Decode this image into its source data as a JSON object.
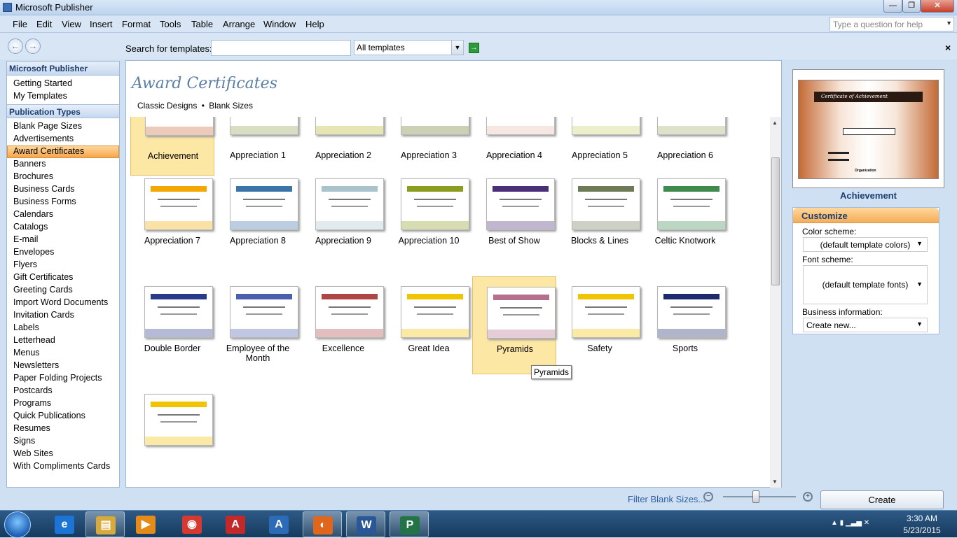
{
  "window": {
    "title": "Microsoft Publisher",
    "min_glyph": "—",
    "max_glyph": "❐",
    "close_glyph": "✕"
  },
  "menu": [
    "File",
    "Edit",
    "View",
    "Insert",
    "Format",
    "Tools",
    "Table",
    "Arrange",
    "Window",
    "Help"
  ],
  "help_box": {
    "placeholder": "Type a question for help"
  },
  "toolbar": {
    "back_glyph": "←",
    "forward_glyph": "→",
    "search_label": "Search for templates:",
    "search_value": "",
    "template_filter": "All templates",
    "go_glyph": "→",
    "close_glyph": "×"
  },
  "sidebar": {
    "section1_title": "Microsoft Publisher",
    "section1_items": [
      "Getting Started",
      "My Templates"
    ],
    "section2_title": "Publication Types",
    "section2_items": [
      "Blank Page Sizes",
      "Advertisements",
      "Award Certificates",
      "Banners",
      "Brochures",
      "Business Cards",
      "Business Forms",
      "Calendars",
      "Catalogs",
      "E-mail",
      "Envelopes",
      "Flyers",
      "Gift Certificates",
      "Greeting Cards",
      "Import Word Documents",
      "Invitation Cards",
      "Labels",
      "Letterhead",
      "Menus",
      "Newsletters",
      "Paper Folding Projects",
      "Postcards",
      "Programs",
      "Quick Publications",
      "Resumes",
      "Signs",
      "Web Sites",
      "With Compliments Cards"
    ],
    "selected": "Award Certificates"
  },
  "main": {
    "title": "Award Certificates",
    "links": [
      "Classic Designs",
      "Blank Sizes"
    ],
    "link_separator": "•"
  },
  "templates": [
    {
      "name": "Achievement",
      "selected": true,
      "color": "#c86a3a"
    },
    {
      "name": "Appreciation  1",
      "color": "#8ca04c"
    },
    {
      "name": "Appreciation  2",
      "color": "#b5b828"
    },
    {
      "name": "Appreciation  3",
      "color": "#6d7b2e"
    },
    {
      "name": "Appreciation  4",
      "color": "#e6b9b0"
    },
    {
      "name": "Appreciation  5",
      "color": "#c7d06e"
    },
    {
      "name": "Appreciation  6",
      "color": "#a3ad6b"
    },
    {
      "name": "Appreciation  7",
      "color": "#f2a800"
    },
    {
      "name": "Appreciation  8",
      "color": "#3b74a8"
    },
    {
      "name": "Appreciation  9",
      "color": "#a9c3cc"
    },
    {
      "name": "Appreciation 10",
      "color": "#8b9d1e"
    },
    {
      "name": "Best of Show",
      "color": "#4a2f78"
    },
    {
      "name": "Blocks & Lines",
      "color": "#6c7b56"
    },
    {
      "name": "Celtic Knotwork",
      "color": "#3f8b4d"
    },
    {
      "name": "Double Border",
      "color": "#2a3a8a"
    },
    {
      "name": "Employee of the Month",
      "color": "#4a5fae"
    },
    {
      "name": "Excellence",
      "color": "#b04545"
    },
    {
      "name": "Great Idea",
      "color": "#f0c400"
    },
    {
      "name": "Pyramids",
      "selected": true,
      "color": "#b5708f"
    },
    {
      "name": "Safety",
      "color": "#f0c400"
    },
    {
      "name": "Sports",
      "color": "#1e2a6e"
    },
    {
      "name": "",
      "color": "#f0c400"
    }
  ],
  "tooltip": "Pyramids",
  "preview": {
    "name": "Achievement",
    "cert_title": "Certificate of Achievement",
    "org": "Organization"
  },
  "customize": {
    "title": "Customize",
    "color_label": "Color scheme:",
    "color_value": "(default template colors)",
    "font_label": "Font scheme:",
    "font_value": "(default template fonts)",
    "business_label": "Business information:",
    "business_value": "Create new..."
  },
  "status": {
    "filter_link": "Filter Blank Sizes...",
    "zoom_out_glyph": "−",
    "zoom_in_glyph": "+",
    "zoom_fraction": 0.45,
    "create_label": "Create"
  },
  "taskbar": {
    "apps": [
      {
        "name": "internet-explorer",
        "glyph": "e",
        "color": "#1c74d4"
      },
      {
        "name": "file-explorer",
        "glyph": "▤",
        "color": "#d9a93a",
        "active": true
      },
      {
        "name": "media-player",
        "glyph": "▶",
        "color": "#e58b1a"
      },
      {
        "name": "chrome",
        "glyph": "◉",
        "color": "#d6392f"
      },
      {
        "name": "acrobat",
        "glyph": "A",
        "color": "#c22a2a"
      },
      {
        "name": "app-a",
        "glyph": "A",
        "color": "#2b6bb8"
      },
      {
        "name": "firefox",
        "glyph": "◐",
        "color": "#e0661b",
        "active": true
      },
      {
        "name": "word",
        "glyph": "W",
        "color": "#2b5797",
        "active": true
      },
      {
        "name": "publisher",
        "glyph": "P",
        "color": "#227447",
        "active": true
      }
    ],
    "tray_icons": "▲  ▮  ▁▃▅  ✕",
    "time": "3:30 AM",
    "date": "5/23/2015"
  }
}
